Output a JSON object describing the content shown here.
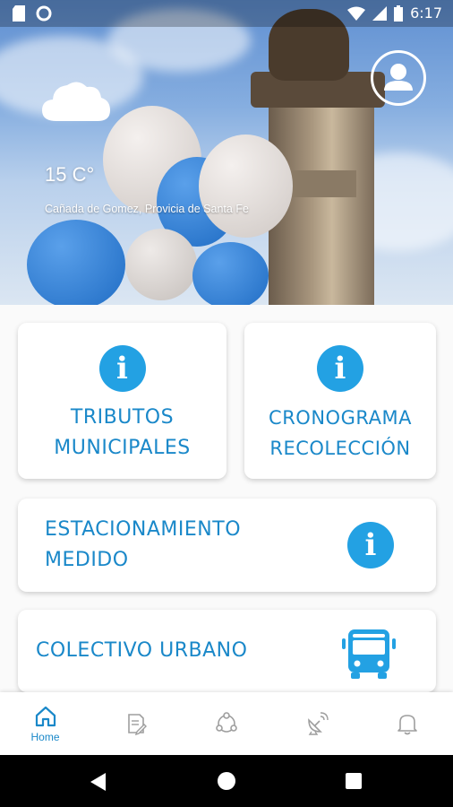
{
  "status_bar": {
    "time": "6:17"
  },
  "header": {
    "temperature": "15 C°",
    "location": "Cañada de Gomez, Provicia de Santa Fe",
    "weather_icon": "cloud-icon",
    "profile_icon": "user-profile-icon"
  },
  "cards": {
    "tributos": {
      "line1": "TRIBUTOS",
      "line2": "MUNICIPALES",
      "icon": "info-icon"
    },
    "cronograma": {
      "line1": "CRONOGRAMA",
      "line2": "RECOLECCIÓN",
      "icon": "info-icon"
    },
    "estacionamiento": {
      "line1": "ESTACIONAMIENTO",
      "line2": "MEDIDO",
      "icon": "info-icon"
    },
    "colectivo": {
      "label": "COLECTIVO URBANO",
      "icon": "bus-icon"
    }
  },
  "bottom_nav": {
    "items": [
      {
        "label": "Home",
        "icon": "home-icon",
        "active": true
      },
      {
        "label": "",
        "icon": "document-edit-icon",
        "active": false
      },
      {
        "label": "",
        "icon": "share-network-icon",
        "active": false
      },
      {
        "label": "",
        "icon": "satellite-dish-icon",
        "active": false
      },
      {
        "label": "",
        "icon": "bell-icon",
        "active": false
      }
    ]
  },
  "colors": {
    "accent": "#1a88c9",
    "info_icon": "#23a1e3"
  }
}
